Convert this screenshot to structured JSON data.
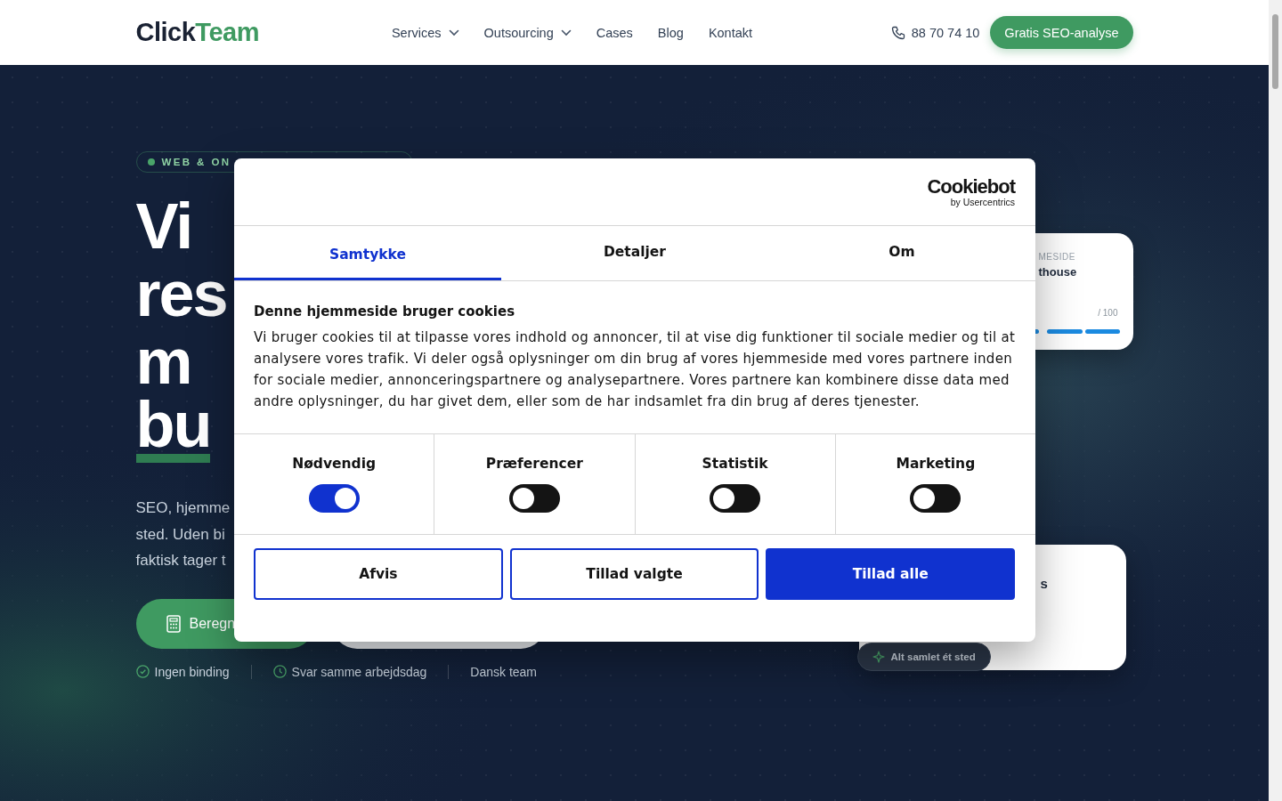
{
  "header": {
    "logo": {
      "part_1": "Click",
      "part_2": "Team"
    },
    "nav": [
      {
        "label": "Services",
        "dropdown": true
      },
      {
        "label": "Outsourcing",
        "dropdown": true
      },
      {
        "label": "Cases",
        "dropdown": false
      },
      {
        "label": "Blog",
        "dropdown": false
      },
      {
        "label": "Kontakt",
        "dropdown": false
      }
    ],
    "phone": "88 70 74 10",
    "cta": "Gratis SEO-analyse"
  },
  "hero": {
    "eyebrow": "WEB & ON",
    "title_lines": [
      "Vi",
      "res",
      "m",
      "bu"
    ],
    "intro_lines": [
      "SEO, hjemme",
      "sted. Uden bi",
      "faktisk tager t"
    ],
    "primary_button": "Beregn",
    "trust": [
      {
        "label": "Ingen binding",
        "kind": "check"
      },
      {
        "label": "Svar samme arbejdsdag",
        "kind": "clock"
      },
      {
        "label": "Dansk team",
        "kind": "plain"
      }
    ],
    "card_1": {
      "eyebrow": "MESIDE",
      "title": "thouse",
      "score_suffix": "/ 100"
    },
    "card_2": {
      "title": "s",
      "badge": "Alt samlet ét sted"
    }
  },
  "cookie_dialog": {
    "logo": {
      "name": "Cookiebot",
      "byline": "by Usercentrics"
    },
    "tabs": [
      {
        "label": "Samtykke",
        "selected": true
      },
      {
        "label": "Detaljer",
        "selected": false
      },
      {
        "label": "Om",
        "selected": false
      }
    ],
    "heading": "Denne hjemmeside bruger cookies",
    "body": "Vi bruger cookies til at tilpasse vores indhold og annoncer, til at vise dig funktioner til sociale medier og til at analysere vores trafik. Vi deler også oplysninger om din brug af vores hjemmeside med vores partnere inden for sociale medier, annonceringspartnere og analysepartnere. Vores partnere kan kombinere disse data med andre oplysninger, du har givet dem, eller som de har indsamlet fra din brug af deres tjenester.",
    "categories": [
      {
        "label": "Nødvendig",
        "on": true
      },
      {
        "label": "Præferencer",
        "on": false
      },
      {
        "label": "Statistik",
        "on": false
      },
      {
        "label": "Marketing",
        "on": false
      }
    ],
    "buttons": [
      {
        "label": "Afvis",
        "kind": "outline"
      },
      {
        "label": "Tillad valgte",
        "kind": "outline"
      },
      {
        "label": "Tillad alle",
        "kind": "filled"
      }
    ]
  }
}
